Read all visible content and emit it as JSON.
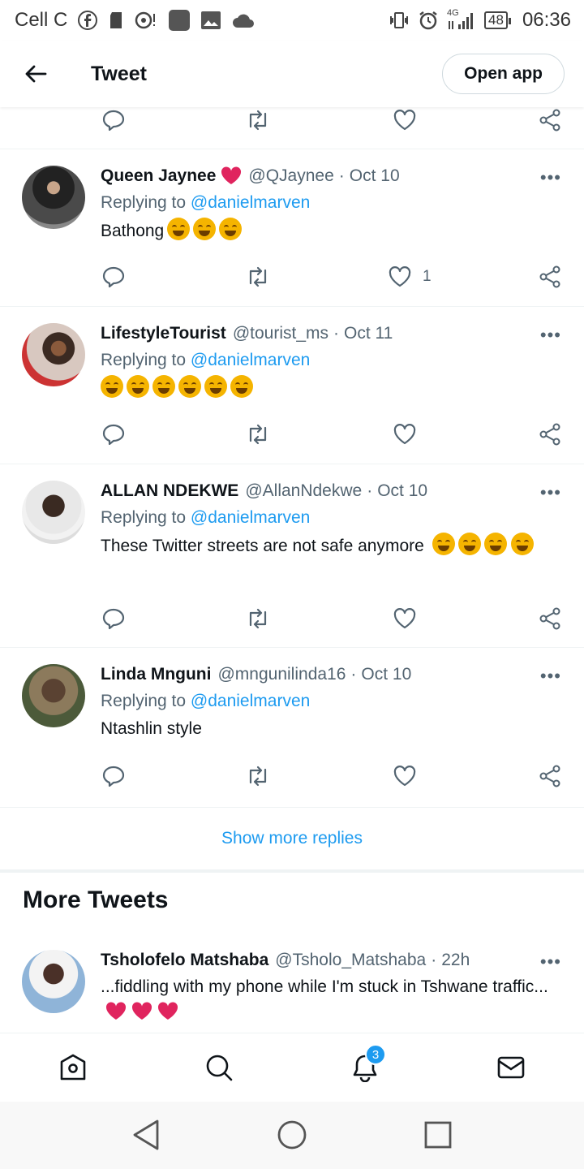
{
  "status_bar": {
    "carrier": "Cell C",
    "network": "4G",
    "battery": "48",
    "time": "06:36"
  },
  "header": {
    "title": "Tweet",
    "open_app": "Open app"
  },
  "tweets": [
    {
      "name": "Queen Jaynee",
      "handle": "@QJaynee",
      "time": "Oct 10",
      "replying_prefix": "Replying to",
      "mention": "@danielmarven",
      "text": "Bathong",
      "likes": "1"
    },
    {
      "name": "LifestyleTourist",
      "handle": "@tourist_ms",
      "time": "Oct 11",
      "replying_prefix": "Replying to",
      "mention": "@danielmarven",
      "text": ""
    },
    {
      "name": "ALLAN NDEKWE",
      "handle": "@AllanNdekwe",
      "time": "Oct 10",
      "replying_prefix": "Replying to",
      "mention": "@danielmarven",
      "text": "These Twitter streets are not safe anymore"
    },
    {
      "name": "Linda Mnguni",
      "handle": "@mngunilinda16",
      "time": "Oct 10",
      "replying_prefix": "Replying to",
      "mention": "@danielmarven",
      "text": "Ntashlin style"
    }
  ],
  "show_more": "Show more replies",
  "more_tweets": {
    "heading": "More Tweets",
    "tweet": {
      "name": "Tsholofelo Matshaba",
      "handle": "@Tsholo_Matshaba",
      "time": "22h",
      "text": "...fiddling with my phone while I'm stuck in Tshwane traffic..."
    }
  },
  "bottom_nav": {
    "notifications_badge": "3"
  },
  "colors": {
    "accent": "#1d9bf0",
    "heart": "#e0245e",
    "secondary_text": "#536471"
  }
}
